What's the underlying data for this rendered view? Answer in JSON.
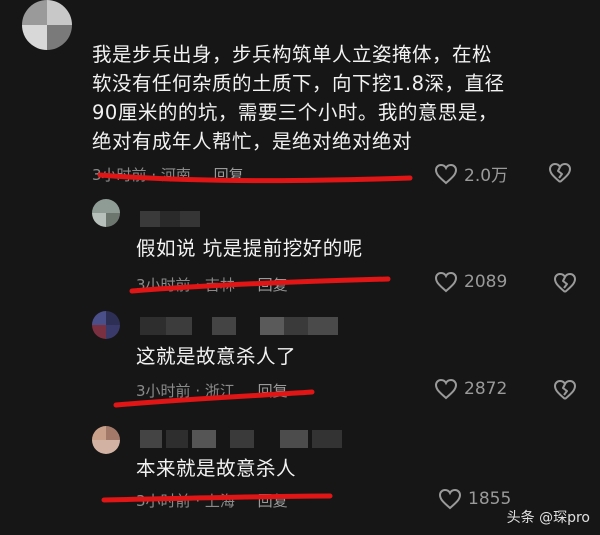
{
  "comments": [
    {
      "text_lines": [
        "我是步兵出身，步兵构筑单人立姿掩体，在松",
        "软没有任何杂质的土质下，向下挖1.8深，直径",
        "90厘米的的坑，需要三个小时。我的意思是，",
        "绝对有成年人帮忙，是绝对绝对绝对"
      ],
      "time": "3小时前",
      "location": "河南",
      "reply_label": "回复",
      "likes": "2.0万"
    },
    {
      "text_lines": [
        "假如说 坑是提前挖好的呢"
      ],
      "time": "3小时前",
      "location": "吉林",
      "reply_label": "回复",
      "likes": "2089"
    },
    {
      "text_lines": [
        "这就是故意杀人了"
      ],
      "time": "3小时前",
      "location": "浙江",
      "reply_label": "回复",
      "likes": "2872"
    },
    {
      "text_lines": [
        "本来就是故意杀人"
      ],
      "time": "3小时前",
      "location": "上海",
      "reply_label": "回复",
      "likes": "1855"
    }
  ],
  "watermark": {
    "text": "头条 @琛pro"
  },
  "colors": {
    "background": "#161616",
    "annotation_red": "#e01515",
    "meta_gray": "#8a8a8a"
  }
}
